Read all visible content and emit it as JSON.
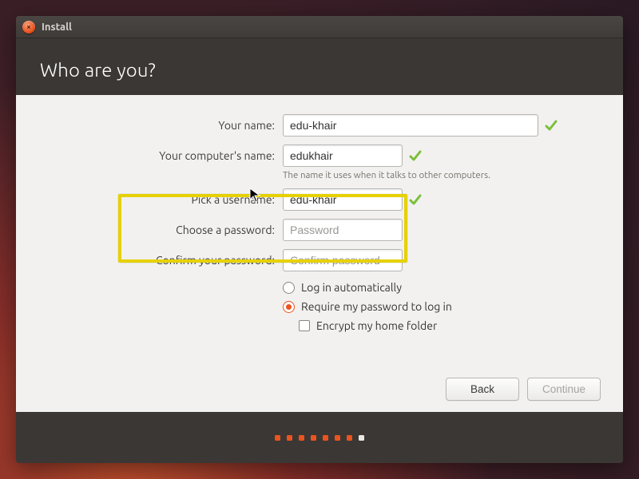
{
  "window": {
    "title": "Install"
  },
  "header": {
    "title": "Who are you?"
  },
  "form": {
    "your_name": {
      "label": "Your name:",
      "value": "edu-khair"
    },
    "computer_name": {
      "label": "Your computer's name:",
      "value": "edukhair",
      "hint": "The name it uses when it talks to other computers."
    },
    "username": {
      "label": "Pick a username:",
      "value": "edu-khair"
    },
    "password": {
      "label": "Choose a password:",
      "placeholder": "Password",
      "value": ""
    },
    "confirm": {
      "label": "Confirm your password:",
      "placeholder": "Confirm password",
      "value": ""
    }
  },
  "options": {
    "auto_login": {
      "label": "Log in automatically",
      "selected": false
    },
    "require_pw": {
      "label": "Require my password to log in",
      "selected": true
    },
    "encrypt": {
      "label": "Encrypt my home folder",
      "checked": false
    }
  },
  "actions": {
    "back": "Back",
    "continue": "Continue",
    "continue_enabled": false
  },
  "pager": {
    "total": 8,
    "active_index": 7
  },
  "colors": {
    "accent": "#e95420",
    "highlight": "#e6d100",
    "check": "#7bbf3a"
  }
}
